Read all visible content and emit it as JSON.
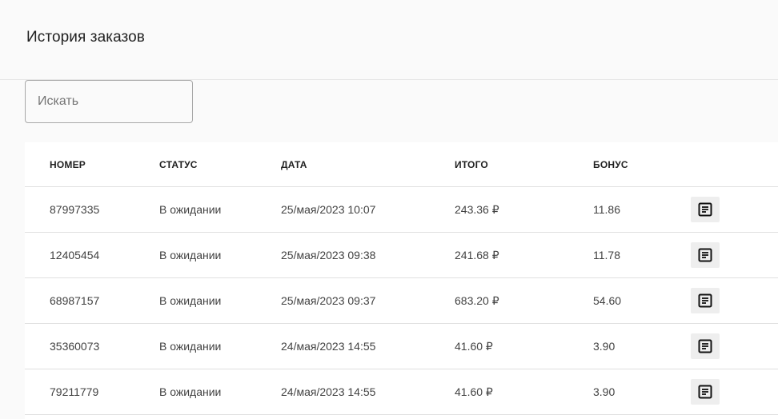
{
  "page": {
    "title": "История заказов"
  },
  "search": {
    "placeholder": "Искать",
    "value": ""
  },
  "table": {
    "headers": {
      "number": "НОМЕР",
      "status": "СТАТУС",
      "date": "ДАТА",
      "total": "ИТОГО",
      "bonus": "БОНУС"
    },
    "rows": [
      {
        "number": "87997335",
        "status": "В ожидании",
        "date": "25/мая/2023 10:07",
        "total": "243.36 ₽",
        "bonus": "11.86",
        "action_icon": "receipt-icon"
      },
      {
        "number": "12405454",
        "status": "В ожидании",
        "date": "25/мая/2023 09:38",
        "total": "241.68 ₽",
        "bonus": "11.78",
        "action_icon": "receipt-icon"
      },
      {
        "number": "68987157",
        "status": "В ожидании",
        "date": "25/мая/2023 09:37",
        "total": "683.20 ₽",
        "bonus": "54.60",
        "action_icon": "receipt-icon"
      },
      {
        "number": "35360073",
        "status": "В ожидании",
        "date": "24/мая/2023 14:55",
        "total": "41.60 ₽",
        "bonus": "3.90",
        "action_icon": "receipt-icon"
      },
      {
        "number": "79211779",
        "status": "В ожидании",
        "date": "24/мая/2023 14:55",
        "total": "41.60 ₽",
        "bonus": "3.90",
        "action_icon": "receipt-icon"
      }
    ]
  },
  "colors": {
    "background": "#fafafa",
    "card": "#ffffff",
    "text": "#212121",
    "border": "#e0e0e0",
    "button_bg": "#eeeeee"
  }
}
